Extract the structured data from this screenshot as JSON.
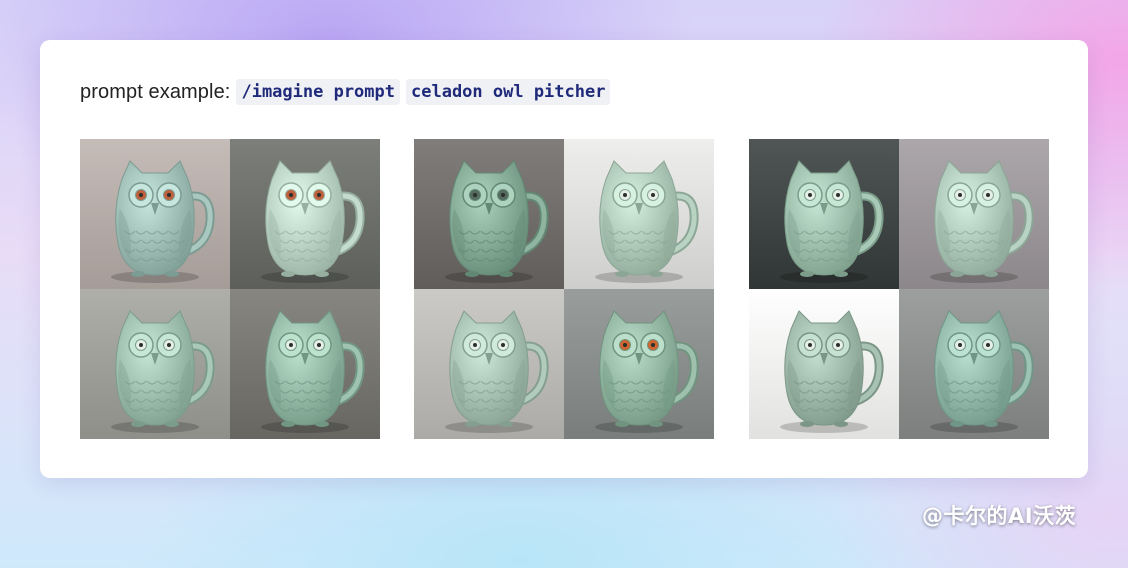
{
  "prompt": {
    "label": "prompt example:",
    "command": "/imagine prompt",
    "text": "celadon owl pitcher"
  },
  "image_grids": [
    {
      "tiles": [
        {
          "bg": "#b3aaa6",
          "glaze": "#a9c8c0",
          "eye": "#c0603a"
        },
        {
          "bg": "#6a6d68",
          "glaze": "#c3dccd",
          "eye": "#c0603a"
        },
        {
          "bg": "#9c9d97",
          "glaze": "#a9c9b8",
          "eye": "#e6efe8"
        },
        {
          "bg": "#75746f",
          "glaze": "#9ec4b0",
          "eye": "#e6efe8"
        }
      ]
    },
    {
      "tiles": [
        {
          "bg": "#6e6b68",
          "glaze": "#8fb5a0",
          "eye": "#556b5f"
        },
        {
          "bg": "#dcdcda",
          "glaze": "#b9d3c3",
          "eye": "#e6efe8"
        },
        {
          "bg": "#b9b8b5",
          "glaze": "#b1cbbd",
          "eye": "#e6efe8"
        },
        {
          "bg": "#878b89",
          "glaze": "#9dc1ac",
          "eye": "#d0642e"
        }
      ]
    },
    {
      "tiles": [
        {
          "bg": "#3e4443",
          "glaze": "#a7c9b6",
          "eye": "#e6efe8"
        },
        {
          "bg": "#9a9598",
          "glaze": "#b8d3c4",
          "eye": "#e6efe8"
        },
        {
          "bg": "#efefed",
          "glaze": "#a8c3b3",
          "eye": "#e6efe8"
        },
        {
          "bg": "#8a8d8b",
          "glaze": "#9cc3b4",
          "eye": "#e6efe8"
        }
      ]
    }
  ],
  "watermark": "@卡尔的AI沃茨"
}
